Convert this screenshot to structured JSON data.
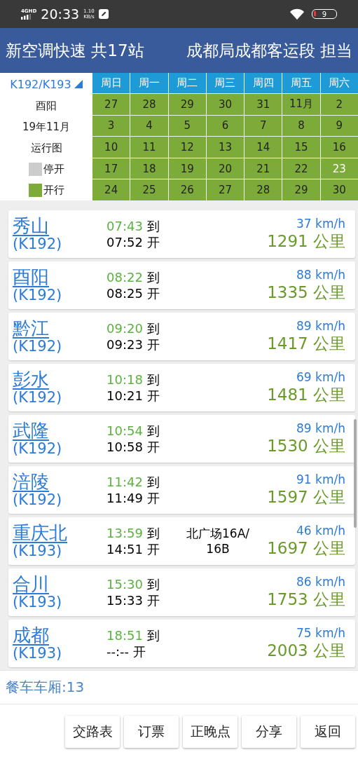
{
  "status_bar": {
    "network": "4GHD",
    "time": "20:33",
    "speed_value": "1.10",
    "speed_unit": "KB/s",
    "battery": "9"
  },
  "header": {
    "train_type": "新空调快速 共17站",
    "operator": "成都局成都客运段 担当"
  },
  "calendar": {
    "train": "K192/K193",
    "station": "酉阳",
    "month": "19年11月",
    "caption": "运行图",
    "legend": [
      {
        "label": "停开",
        "running": false
      },
      {
        "label": "开行",
        "running": true
      }
    ],
    "weekdays": [
      "周日",
      "周一",
      "周二",
      "周三",
      "周四",
      "周五",
      "周六"
    ],
    "days": [
      {
        "label": "27",
        "running": true,
        "today": false
      },
      {
        "label": "28",
        "running": true,
        "today": false
      },
      {
        "label": "29",
        "running": true,
        "today": false
      },
      {
        "label": "30",
        "running": true,
        "today": false
      },
      {
        "label": "31",
        "running": true,
        "today": false
      },
      {
        "label": "11月",
        "running": true,
        "today": false
      },
      {
        "label": "2",
        "running": true,
        "today": false
      },
      {
        "label": "3",
        "running": true,
        "today": false
      },
      {
        "label": "4",
        "running": true,
        "today": false
      },
      {
        "label": "5",
        "running": true,
        "today": false
      },
      {
        "label": "6",
        "running": true,
        "today": false
      },
      {
        "label": "7",
        "running": true,
        "today": false
      },
      {
        "label": "8",
        "running": true,
        "today": false
      },
      {
        "label": "9",
        "running": true,
        "today": false
      },
      {
        "label": "10",
        "running": true,
        "today": false
      },
      {
        "label": "11",
        "running": true,
        "today": false
      },
      {
        "label": "12",
        "running": true,
        "today": false
      },
      {
        "label": "13",
        "running": true,
        "today": false
      },
      {
        "label": "14",
        "running": true,
        "today": false
      },
      {
        "label": "15",
        "running": true,
        "today": false
      },
      {
        "label": "16",
        "running": true,
        "today": false
      },
      {
        "label": "17",
        "running": true,
        "today": false
      },
      {
        "label": "18",
        "running": true,
        "today": false
      },
      {
        "label": "19",
        "running": true,
        "today": false
      },
      {
        "label": "20",
        "running": true,
        "today": false
      },
      {
        "label": "21",
        "running": true,
        "today": false
      },
      {
        "label": "22",
        "running": true,
        "today": false
      },
      {
        "label": "23",
        "running": true,
        "today": true
      },
      {
        "label": "24",
        "running": true,
        "today": false
      },
      {
        "label": "25",
        "running": true,
        "today": false
      },
      {
        "label": "26",
        "running": true,
        "today": false
      },
      {
        "label": "27",
        "running": true,
        "today": false
      },
      {
        "label": "28",
        "running": true,
        "today": false
      },
      {
        "label": "29",
        "running": true,
        "today": false
      },
      {
        "label": "30",
        "running": true,
        "today": false
      }
    ]
  },
  "stations": [
    {
      "name": "秀山",
      "train": "(K192)",
      "arrive": "07:43",
      "arrive_label": "到",
      "depart": "07:52",
      "depart_label": "开",
      "speed": "37 km/h",
      "distance": "1291 公里"
    },
    {
      "name": "酉阳",
      "train": "(K192)",
      "arrive": "08:22",
      "arrive_label": "到",
      "depart": "08:25",
      "depart_label": "开",
      "speed": "88 km/h",
      "distance": "1335 公里"
    },
    {
      "name": "黔江",
      "train": "(K192)",
      "arrive": "09:20",
      "arrive_label": "到",
      "depart": "09:23",
      "depart_label": "开",
      "speed": "89 km/h",
      "distance": "1417 公里"
    },
    {
      "name": "彭水",
      "train": "(K192)",
      "arrive": "10:18",
      "arrive_label": "到",
      "depart": "10:21",
      "depart_label": "开",
      "speed": "69 km/h",
      "distance": "1481 公里"
    },
    {
      "name": "武隆",
      "train": "(K192)",
      "arrive": "10:54",
      "arrive_label": "到",
      "depart": "10:58",
      "depart_label": "开",
      "speed": "89 km/h",
      "distance": "1530 公里"
    },
    {
      "name": "涪陵",
      "train": "(K192)",
      "arrive": "11:42",
      "arrive_label": "到",
      "depart": "11:49",
      "depart_label": "开",
      "speed": "91 km/h",
      "distance": "1597 公里"
    },
    {
      "name": "重庆北",
      "train": "(K193)",
      "arrive": "13:59",
      "arrive_label": "到",
      "depart": "14:51",
      "depart_label": "开",
      "platform": [
        "北广场16A/",
        "16B"
      ],
      "speed": "46 km/h",
      "distance": "1697 公里"
    },
    {
      "name": "合川",
      "train": "(K193)",
      "arrive": "15:30",
      "arrive_label": "到",
      "depart": "15:33",
      "depart_label": "开",
      "speed": "86 km/h",
      "distance": "1753 公里"
    },
    {
      "name": "成都",
      "train": "(K193)",
      "arrive": "18:51",
      "arrive_label": "到",
      "depart": "--:--",
      "depart_label": "开",
      "speed": "75 km/h",
      "distance": "2003 公里"
    }
  ],
  "dining_car": "餐车车厢:13",
  "buttons": [
    "交路表",
    "订票",
    "正晚点",
    "分享",
    "返回"
  ]
}
